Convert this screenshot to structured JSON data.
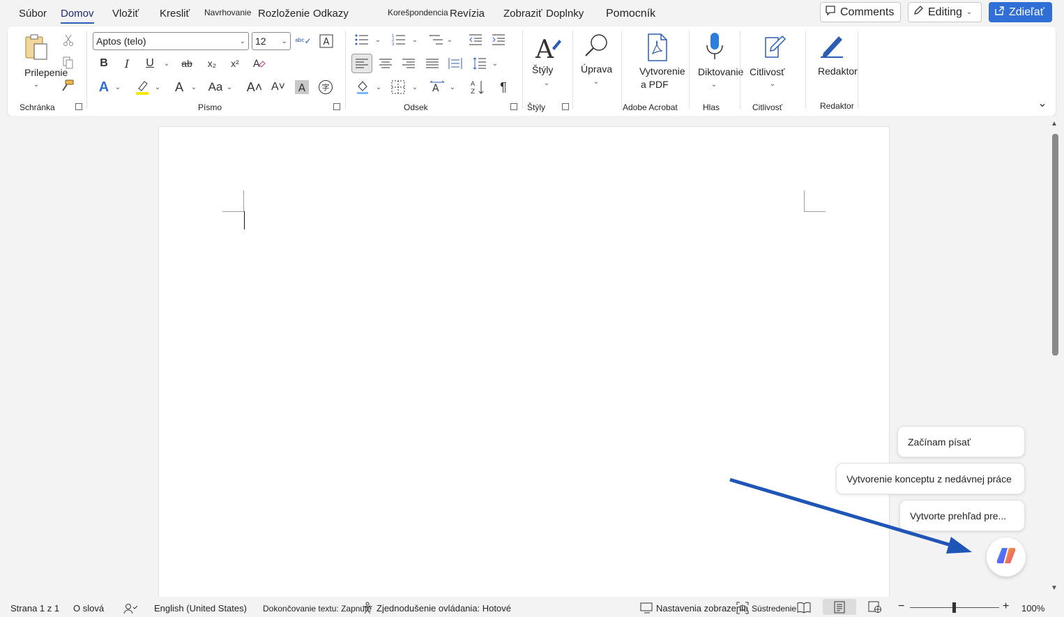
{
  "menu": {
    "tabs": [
      {
        "label": "Súbor"
      },
      {
        "label": "Domov"
      },
      {
        "label": "Vložiť"
      },
      {
        "label": "Kresliť"
      },
      {
        "label": "Navrhovanie"
      },
      {
        "label": "Rozloženie"
      },
      {
        "label": "Odkazy"
      },
      {
        "label": "Korešpondencia"
      },
      {
        "label": "Revízia"
      },
      {
        "label": "Zobraziť"
      },
      {
        "label": "Doplnky"
      },
      {
        "label": "Pomocník"
      }
    ],
    "comments_label": "Comments",
    "editing_label": "Editing",
    "share_label": "Zdieľať"
  },
  "ribbon": {
    "clipboard": {
      "paste_label": "Prilepenie",
      "group_label": "Schránka"
    },
    "font": {
      "font_name": "Aptos (telo)",
      "font_size": "12",
      "group_label": "Písmo"
    },
    "paragraph": {
      "group_label": "Odsek"
    },
    "styles": {
      "label": "Štýly",
      "group_label": "Štýly"
    },
    "editing": {
      "label": "Úprava"
    },
    "acrobat": {
      "label_line1": "Vytvorenie",
      "label_line2": "a PDF",
      "group_label": "Adobe Acrobat"
    },
    "voice": {
      "label": "Diktovanie",
      "group_label": "Hlas"
    },
    "sensitivity": {
      "label": "Citlivosť",
      "group_label": "Citlivosť"
    },
    "editor": {
      "label": "Redaktor",
      "group_label": "Redaktor"
    }
  },
  "suggestions": [
    {
      "label": "Začínam písať"
    },
    {
      "label": "Vytvorenie konceptu z nedávnej práce"
    },
    {
      "label": "Vytvorte prehľad pre..."
    }
  ],
  "status": {
    "page": "Strana 1 z 1",
    "words": "O slová",
    "language": "English (United States)",
    "text_prediction": "Dokončovanie textu: Zapnuté",
    "accessibility": "Zjednodušenie ovládania: Hotové",
    "display_settings": "Nastavenia zobrazenia",
    "focus": "Sústredenie",
    "zoom": "100%"
  },
  "colors": {
    "accent": "#2f6fd6",
    "arrow": "#1f55b7"
  }
}
